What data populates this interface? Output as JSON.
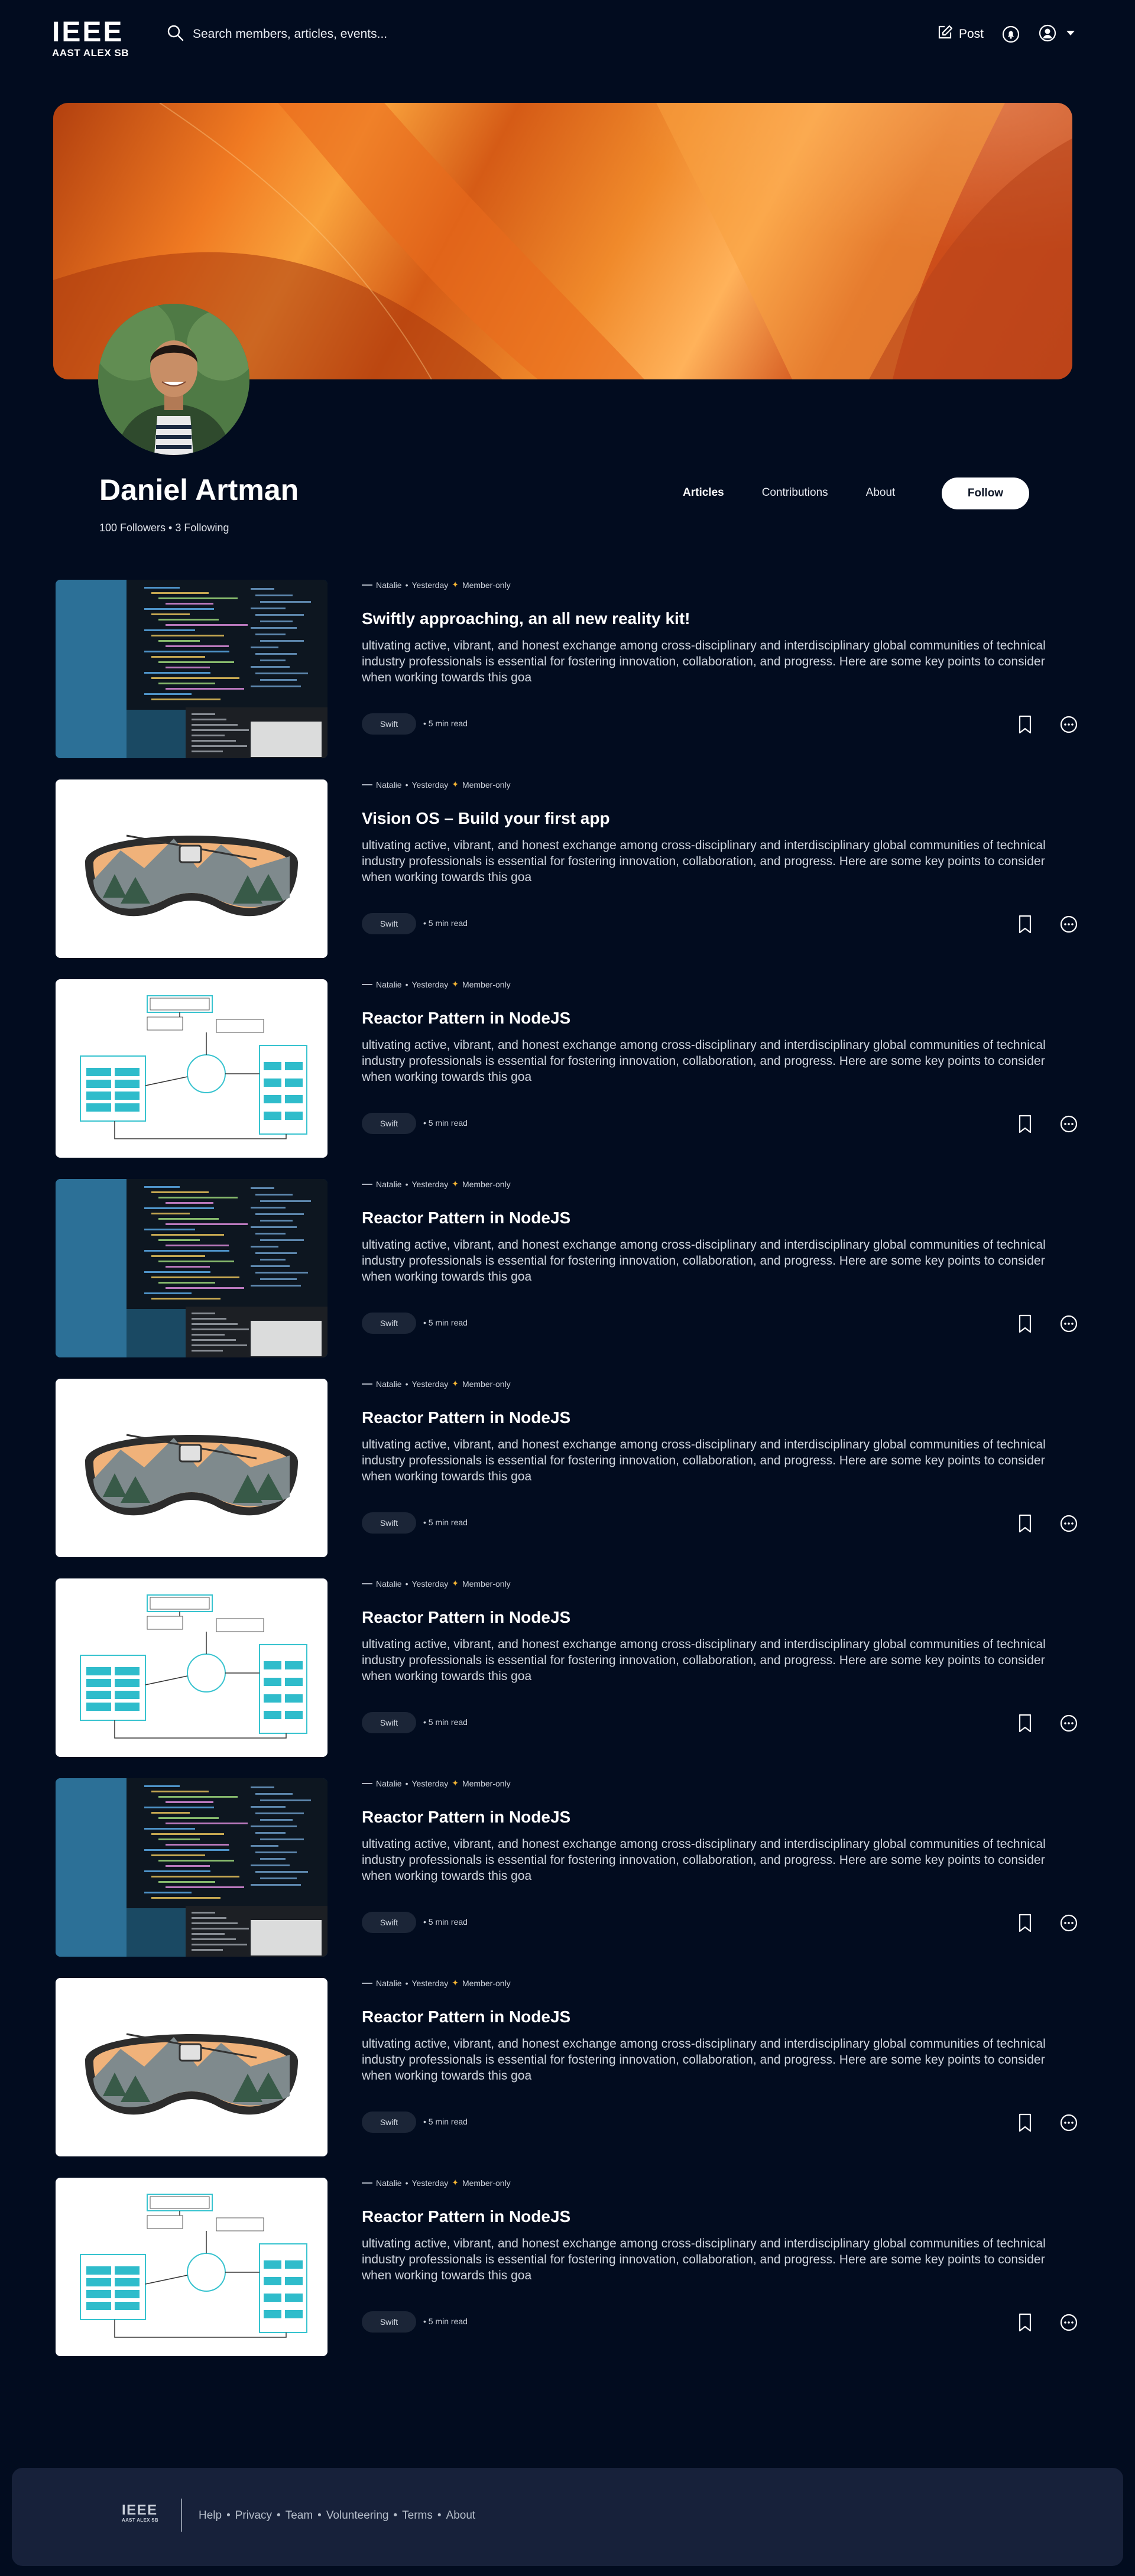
{
  "header": {
    "logo_main": "IEEE",
    "logo_sub": "AAST ALEX SB",
    "search_placeholder": "Search members, articles, events...",
    "post_label": "Post"
  },
  "profile": {
    "name": "Daniel Artman",
    "stats": "100 Followers • 3 Following",
    "tabs": [
      "Articles",
      "Contributions",
      "About"
    ],
    "active_tab": "Articles",
    "follow_label": "Follow"
  },
  "articles": [
    {
      "author": "Natalie",
      "date": "Yesterday",
      "badge": "Member-only",
      "title": "Swiftly approaching, an all new reality kit!",
      "excerpt": "ultivating active, vibrant, and honest exchange among cross-disciplinary and interdisciplinary global communities of technical industry professionals is essential for fostering innovation, collaboration, and progress. Here are some key points to consider when working towards this goa",
      "tag": "Swift",
      "read_time": "• 5 min read",
      "thumb": "code-screen"
    },
    {
      "author": "Natalie",
      "date": "Yesterday",
      "badge": "Member-only",
      "title": "Vision OS – Build your first app",
      "excerpt": "ultivating active, vibrant, and honest exchange among cross-disciplinary and interdisciplinary global communities of technical industry professionals is essential for fostering innovation, collaboration, and progress. Here are some key points to consider when working towards this goa",
      "tag": "Swift",
      "read_time": "• 5 min read",
      "thumb": "ski-goggles"
    },
    {
      "author": "Natalie",
      "date": "Yesterday",
      "badge": "Member-only",
      "title": "Reactor Pattern in NodeJS",
      "excerpt": "ultivating active, vibrant, and honest exchange among cross-disciplinary and interdisciplinary global communities of technical industry professionals is essential for fostering innovation, collaboration, and progress. Here are some key points to consider when working towards this goa",
      "tag": "Swift",
      "read_time": "• 5 min read",
      "thumb": "diagram"
    },
    {
      "author": "Natalie",
      "date": "Yesterday",
      "badge": "Member-only",
      "title": "Reactor Pattern in NodeJS",
      "excerpt": "ultivating active, vibrant, and honest exchange among cross-disciplinary and interdisciplinary global communities of technical industry professionals is essential for fostering innovation, collaboration, and progress. Here are some key points to consider when working towards this goa",
      "tag": "Swift",
      "read_time": "• 5 min read",
      "thumb": "code-screen"
    },
    {
      "author": "Natalie",
      "date": "Yesterday",
      "badge": "Member-only",
      "title": "Reactor Pattern in NodeJS",
      "excerpt": "ultivating active, vibrant, and honest exchange among cross-disciplinary and interdisciplinary global communities of technical industry professionals is essential for fostering innovation, collaboration, and progress. Here are some key points to consider when working towards this goa",
      "tag": "Swift",
      "read_time": "• 5 min read",
      "thumb": "ski-goggles"
    },
    {
      "author": "Natalie",
      "date": "Yesterday",
      "badge": "Member-only",
      "title": "Reactor Pattern in NodeJS",
      "excerpt": "ultivating active, vibrant, and honest exchange among cross-disciplinary and interdisciplinary global communities of technical industry professionals is essential for fostering innovation, collaboration, and progress. Here are some key points to consider when working towards this goa",
      "tag": "Swift",
      "read_time": "• 5 min read",
      "thumb": "diagram"
    },
    {
      "author": "Natalie",
      "date": "Yesterday",
      "badge": "Member-only",
      "title": "Reactor Pattern in NodeJS",
      "excerpt": "ultivating active, vibrant, and honest exchange among cross-disciplinary and interdisciplinary global communities of technical industry professionals is essential for fostering innovation, collaboration, and progress. Here are some key points to consider when working towards this goa",
      "tag": "Swift",
      "read_time": "• 5 min read",
      "thumb": "code-screen"
    },
    {
      "author": "Natalie",
      "date": "Yesterday",
      "badge": "Member-only",
      "title": "Reactor Pattern in NodeJS",
      "excerpt": "ultivating active, vibrant, and honest exchange among cross-disciplinary and interdisciplinary global communities of technical industry professionals is essential for fostering innovation, collaboration, and progress. Here are some key points to consider when working towards this goa",
      "tag": "Swift",
      "read_time": "• 5 min read",
      "thumb": "ski-goggles"
    },
    {
      "author": "Natalie",
      "date": "Yesterday",
      "badge": "Member-only",
      "title": "Reactor Pattern in NodeJS",
      "excerpt": "ultivating active, vibrant, and honest exchange among cross-disciplinary and interdisciplinary global communities of technical industry professionals is essential for fostering innovation, collaboration, and progress. Here are some key points to consider when working towards this goa",
      "tag": "Swift",
      "read_time": "• 5 min read",
      "thumb": "diagram"
    }
  ],
  "footer": {
    "logo_main": "IEEE",
    "logo_sub": "AAST ALEX SB",
    "links": [
      "Help",
      "Privacy",
      "Team",
      "Volunteering",
      "Terms",
      "About"
    ]
  },
  "colors": {
    "background": "#020c1f",
    "footer_bg": "#17213a",
    "tag_bg": "#1b2537",
    "member_star": "#f6b634"
  }
}
